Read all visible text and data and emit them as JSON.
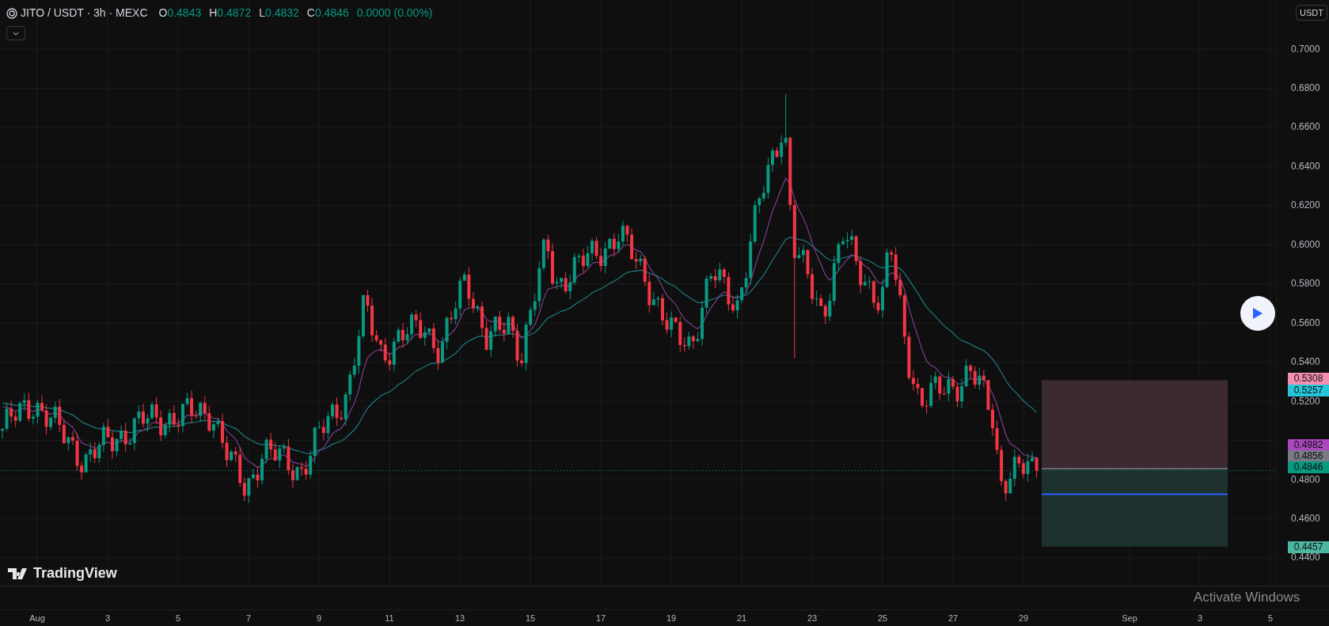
{
  "header": {
    "symbol": "JITO / USDT · 3h · MEXC",
    "ohlc": [
      {
        "label": "O",
        "value": "0.4843"
      },
      {
        "label": "H",
        "value": "0.4872"
      },
      {
        "label": "L",
        "value": "0.4832"
      },
      {
        "label": "C",
        "value": "0.4846"
      }
    ],
    "change": "0.0000 (0.00%)"
  },
  "currency_button": "USDT",
  "price_axis": {
    "ticks": [
      "0.7000",
      "0.6800",
      "0.6600",
      "0.6400",
      "0.6200",
      "0.6000",
      "0.5800",
      "0.5600",
      "0.5400",
      "0.5200",
      "0.4800",
      "0.4600",
      "0.4400"
    ],
    "badges": [
      {
        "text": "0.5308",
        "color": "#f48fb1"
      },
      {
        "text": "0.5257",
        "color": "#26c6da"
      },
      {
        "text": "0.4982",
        "color": "#ab47bc"
      },
      {
        "text": "0.4856",
        "color": "#787b86"
      },
      {
        "text": "0.4846",
        "color": "#089981"
      },
      {
        "text": "0.4457",
        "color": "#4db6a0"
      }
    ]
  },
  "time_axis": [
    "Aug",
    "3",
    "5",
    "7",
    "9",
    "11",
    "13",
    "15",
    "17",
    "19",
    "21",
    "23",
    "25",
    "27",
    "29",
    "Sep",
    "3",
    "5"
  ],
  "logo": "TradingView",
  "os_notice": "Activate Windows"
}
